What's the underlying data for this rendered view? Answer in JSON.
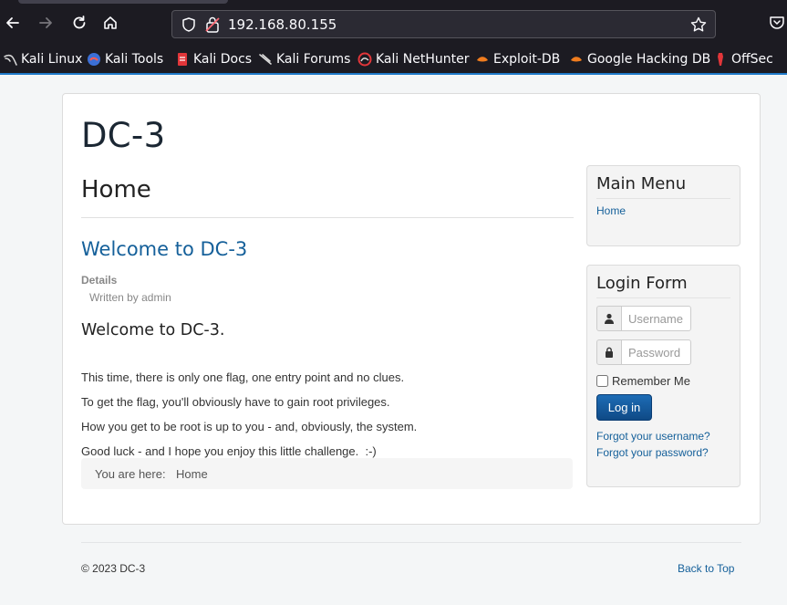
{
  "browser": {
    "url": "192.168.80.155",
    "bookmarks": [
      {
        "label": "Kali Linux",
        "icon": "kali-dragon-icon"
      },
      {
        "label": "Kali Tools",
        "icon": "kali-tools-icon"
      },
      {
        "label": "Kali Docs",
        "icon": "kali-docs-icon"
      },
      {
        "label": "Kali Forums",
        "icon": "kali-forums-icon"
      },
      {
        "label": "Kali NetHunter",
        "icon": "nethunter-icon"
      },
      {
        "label": "Exploit-DB",
        "icon": "exploit-db-icon"
      },
      {
        "label": "Google Hacking DB",
        "icon": "ghdb-icon"
      },
      {
        "label": "OffSec",
        "icon": "offsec-icon"
      }
    ]
  },
  "site": {
    "title": "DC-3"
  },
  "main": {
    "page_heading": "Home",
    "article_title": "Welcome to DC-3",
    "details_label": "Details",
    "written_by": "Written by admin",
    "content_heading": "Welcome to DC-3.",
    "paragraphs": [
      "This time, there is only one flag, one entry point and no clues.",
      "To get the flag, you'll obviously have to gain root privileges.",
      "How you get to be root is up to you - and, obviously, the system.",
      "Good luck - and I hope you enjoy this little challenge.  :-)"
    ],
    "breadcrumb": {
      "label": "You are here:",
      "item": "Home"
    }
  },
  "sidebar": {
    "main_menu": {
      "title": "Main Menu",
      "items": [
        "Home"
      ]
    },
    "login_form": {
      "title": "Login Form",
      "username_placeholder": "Username",
      "password_placeholder": "Password",
      "remember_label": "Remember Me",
      "login_button": "Log in",
      "forgot_username": "Forgot your username?",
      "forgot_password": "Forgot your password?"
    }
  },
  "footer": {
    "copyright": "© 2023 DC-3",
    "back_to_top": "Back to Top"
  },
  "colors": {
    "link": "#15609a",
    "button": "#0f4a86",
    "browser_chrome": "#1c1b22",
    "accent": "#1f7ac9"
  }
}
